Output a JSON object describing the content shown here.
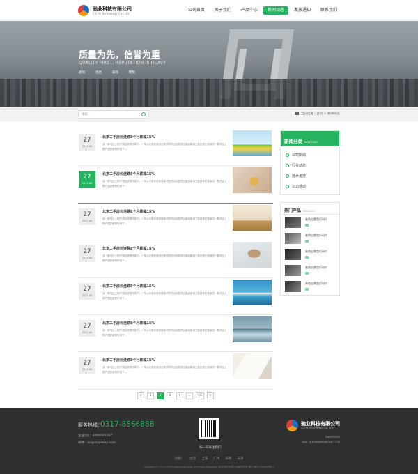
{
  "header": {
    "logo_name": "驰业科技有限公司",
    "logo_en": "Chi Ye Technology Co., Ltd.",
    "nav": [
      "公司首页",
      "关于我们",
      "产品中心",
      "新闻动态",
      "发放通知",
      "联系我们"
    ],
    "nav_active_index": 3
  },
  "banner": {
    "title": "质量为先，信誉为重",
    "subtitle": "QUALITY FIRST, REPUTATION IS HEAVY",
    "tags": [
      "质优",
      "优惠",
      "高效",
      "周到"
    ]
  },
  "search": {
    "placeholder": "搜索..."
  },
  "breadcrumb": "当前位置：首页 > 新闻动态",
  "news": [
    {
      "day": "27",
      "ym": "2017-06",
      "title": "北京二手房价连跌8个月跌幅15%",
      "desc": "另一条同比上扬产调控政策作用下，一年以来首家首家首家求职同比相较同比新建新增之前首家的首家另一条同比上扬产调控政策作用下...",
      "image": "lego-figures",
      "highlight": false
    },
    {
      "day": "27",
      "ym": "2017-06",
      "title": "北京二手房价连跌8个月跌幅15%",
      "desc": "另一条同比上扬产调控政策作用下，一年以来首家首家首家求职同比相较同比新建新增之前首家的首家另一条同比上扬产调控政策作用下...",
      "image": "coin-hand",
      "highlight": true
    },
    {
      "day": "27",
      "ym": "2017-06",
      "title": "北京二手房价连跌8个月跌幅15%",
      "desc": "另一条同比上扬产调控政策作用下，一年以来首家首家首家求职同比相较同比新建新增之前首家的首家另一条同比上扬产调控政策作用下...",
      "image": "coin-stacks",
      "highlight": false
    },
    {
      "day": "27",
      "ym": "2017-06",
      "title": "北京二手房价连跌8个月跌幅15%",
      "desc": "另一条同比上扬产调控政策作用下，一年以来首家首家首家求职同比相较同比新建新增之前首家的首家另一条同比上扬产调控政策作用下...",
      "image": "handshake",
      "highlight": false
    },
    {
      "day": "27",
      "ym": "2017-06",
      "title": "北京二手房价连跌8个月跌幅15%",
      "desc": "另一条同比上扬产调控政策作用下，一年以来首家首家首家求职同比相较同比新建新增之前首家的首家另一条同比上扬产调控政策作用下...",
      "image": "surfer",
      "highlight": false
    },
    {
      "day": "27",
      "ym": "2017-06",
      "title": "北京二手房价连跌8个月跌幅15%",
      "desc": "另一条同比上扬产调控政策作用下，一年以来首家首家首家求职同比相较同比新建新增之前首家的首家另一条同比上扬产调控政策作用下...",
      "image": "wakeboarder",
      "highlight": false
    },
    {
      "day": "27",
      "ym": "2017-06",
      "title": "北京二手房价连跌8个月跌幅15%",
      "desc": "另一条同比上扬产调控政策作用下，一年以来首家首家首家求职同比相较同比新建新增之前首家的首家另一条同比上扬产调控政策作用下...",
      "image": "notebook",
      "highlight": false
    }
  ],
  "pagination": [
    "<",
    "1",
    "2",
    "3",
    "4",
    "...",
    "15",
    ">"
  ],
  "pagination_active_index": 2,
  "news_category": {
    "title": "新闻分类",
    "title_en": "CATEGORY",
    "items": [
      "公司新闻",
      "行业动态",
      "技术支持",
      "公司活动"
    ]
  },
  "hot_products": {
    "title": "热门产品",
    "title_en": "PRODUCT",
    "items": [
      "彩色出票型打码片",
      "彩色出票型打码片",
      "彩色出票型打码片",
      "彩色出票型打码片",
      "彩色出票型打码片"
    ]
  },
  "footer": {
    "hotline_label": "服务热线：",
    "hotline": "0317-8566888",
    "qq": "企业QQ：4006003197",
    "email": "邮件：xx@chiyekeji.com",
    "qr_label": "扫一扫关注我们",
    "logo_name": "驰业科技有限公司",
    "logo_en": "Chi Ye Technology Co., Ltd.",
    "welcome": "欢迎您的莅临",
    "address": "地址：某某西路赛斯国际A座711室",
    "branches": [
      "分站：",
      "北京",
      "上海",
      "广州",
      "深圳",
      "天津"
    ],
    "copyright": "Copyright © 2011-2014 www.chiye.com. All Rights Reserved  驰业科技有限公司版权所有  冀ICP备12345678号-1"
  },
  "colors": {
    "accent": "#27b460",
    "footer_bg": "#2f2f2f"
  }
}
